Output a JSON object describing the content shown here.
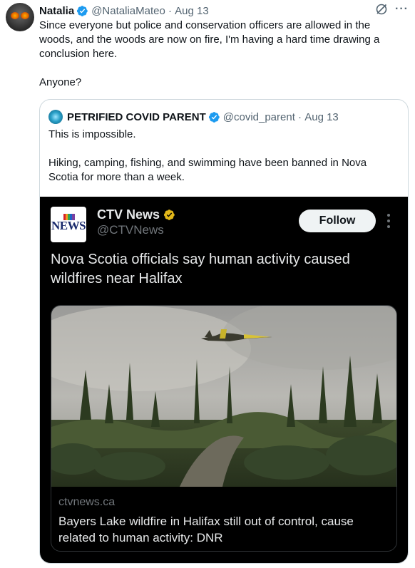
{
  "main_tweet": {
    "display_name": "Natalia",
    "handle": "@NataliaMateo",
    "date": "Aug 13",
    "text_line1": "Since everyone but police and conservation officers are allowed in the",
    "text_line2": "woods, and the woods are now on fire, I'm having a hard time drawing a",
    "text_line3": "conclusion here.",
    "text_line4": "Anyone?",
    "more_icon": "more-horizontal-icon",
    "grok_icon": "slash-circle-icon"
  },
  "quoted_tweet": {
    "display_name": "PETRIFIED COVID PARENT",
    "handle": "@covid_parent",
    "date": "Aug 13",
    "text_line1": "This is impossible.",
    "text_line2": "Hiking, camping, fishing, and swimming have been banned in Nova",
    "text_line3": "Scotia for more than a week."
  },
  "embedded_post": {
    "logo_text": "NEWS",
    "display_name": "CTV News",
    "handle": "@CTVNews",
    "follow_label": "Follow",
    "headline_line1": "Nova Scotia officials say human activity caused",
    "headline_line2": "wildfires near Halifax",
    "link_card": {
      "domain": "ctvnews.ca",
      "title_line1": "Bayers Lake wildfire in Halifax still out of control, cause",
      "title_line2": "related to human activity: DNR",
      "image_description_icon": "wildfire-aircraft-photo"
    }
  },
  "colors": {
    "verified_blue": "#1d9bf0",
    "verified_gold": "#e2b719",
    "muted_text": "#536471",
    "embed_bg": "#000000"
  }
}
